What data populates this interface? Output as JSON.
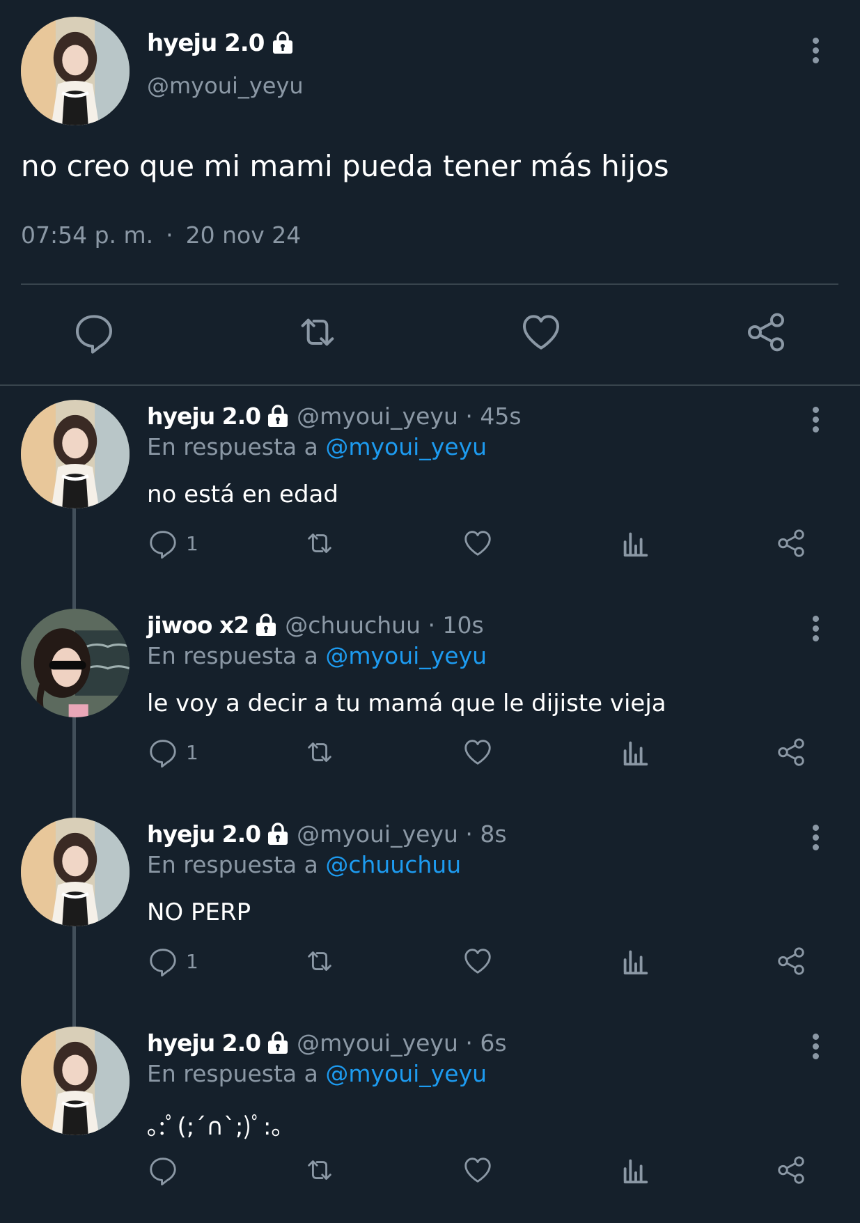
{
  "main_tweet": {
    "name": "hyeju 2.0",
    "handle": "@myoui_yeyu",
    "text": "no creo que mi mami pueda tener más hijos",
    "time": "07:54 p. m.",
    "separator": "·",
    "date": "20 nov 24"
  },
  "replies": [
    {
      "name": "hyeju 2.0",
      "meta": "@myoui_yeyu · 45s",
      "reply_prefix": "En respuesta a ",
      "reply_to": "@myoui_yeyu",
      "text": "no está en edad",
      "reply_count": "1"
    },
    {
      "name": "jiwoo x2",
      "meta": "@chuuchuu · 10s",
      "reply_prefix": "En respuesta a ",
      "reply_to": "@myoui_yeyu",
      "text": "le voy a decir a tu mamá que le dijiste vieja",
      "reply_count": "1"
    },
    {
      "name": "hyeju 2.0",
      "meta": "@myoui_yeyu · 8s",
      "reply_prefix": "En respuesta a ",
      "reply_to": "@chuuchuu",
      "text": "NO PERP",
      "reply_count": "1"
    },
    {
      "name": "hyeju 2.0",
      "meta": "@myoui_yeyu · 6s",
      "reply_prefix": "En respuesta a ",
      "reply_to": "@myoui_yeyu",
      "text": "｡:ﾟ(;´∩`;)ﾟ:｡",
      "reply_count": ""
    }
  ],
  "colors": {
    "background": "#15202b",
    "secondary_text": "#8b98a5",
    "mention": "#1d9bf0",
    "divider": "#38444d"
  },
  "icons": [
    "lock-icon",
    "more-options-icon",
    "reply-icon",
    "retweet-icon",
    "like-icon",
    "views-icon",
    "share-icon"
  ]
}
